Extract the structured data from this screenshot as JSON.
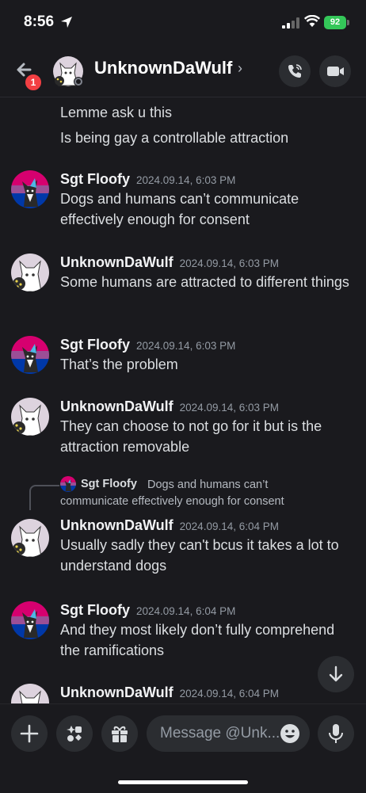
{
  "status_bar": {
    "time": "8:56",
    "battery": "92"
  },
  "header": {
    "back_badge": "1",
    "name": "UnknownDaWulf",
    "chevron": "›"
  },
  "messages": [
    {
      "type": "continuation",
      "lines": [
        "Lemme ask u this",
        "Is being gay a controllable attraction"
      ]
    },
    {
      "author": "Sgt Floofy",
      "timestamp": "2024.09.14, 6:03 PM",
      "text": "Dogs and humans can’t communicate effectively enough for consent"
    },
    {
      "author": "UnknownDaWulf",
      "timestamp": "2024.09.14, 6:03 PM",
      "text": "Some humans are attracted to different things"
    },
    {
      "author": "Sgt Floofy",
      "timestamp": "2024.09.14, 6:03 PM",
      "text": "That’s the problem"
    },
    {
      "author": "UnknownDaWulf",
      "timestamp": "2024.09.14, 6:03 PM",
      "text": "They can choose to not go for it but is the attraction removable"
    },
    {
      "author": "UnknownDaWulf",
      "timestamp": "2024.09.14, 6:04 PM",
      "text": "Usually sadly they can't bcus it takes a lot to understand dogs",
      "reply": {
        "author": "Sgt Floofy",
        "text": "Dogs and humans can’t communicate effectively enough for consent"
      }
    },
    {
      "author": "Sgt Floofy",
      "timestamp": "2024.09.14, 6:04 PM",
      "text": "And they most likely don’t fully comprehend the ramifications"
    },
    {
      "author": "UnknownDaWulf",
      "timestamp": "2024.09.14, 6:04 PM",
      "text": ""
    }
  ],
  "composer": {
    "placeholder": "Message @Unk..."
  },
  "colors": {
    "background": "#1a1a1e",
    "button_bg": "#2b2d31",
    "badge_red": "#f23f43",
    "battery_green": "#34c759",
    "timestamp_gray": "#949ba4"
  },
  "icons": [
    "location-arrow-icon",
    "signal-icon",
    "wifi-icon",
    "back-arrow-icon",
    "phone-call-icon",
    "video-camera-icon",
    "chevron-down-icon",
    "plus-icon",
    "apps-icon",
    "gift-icon",
    "emoji-icon",
    "microphone-icon"
  ]
}
